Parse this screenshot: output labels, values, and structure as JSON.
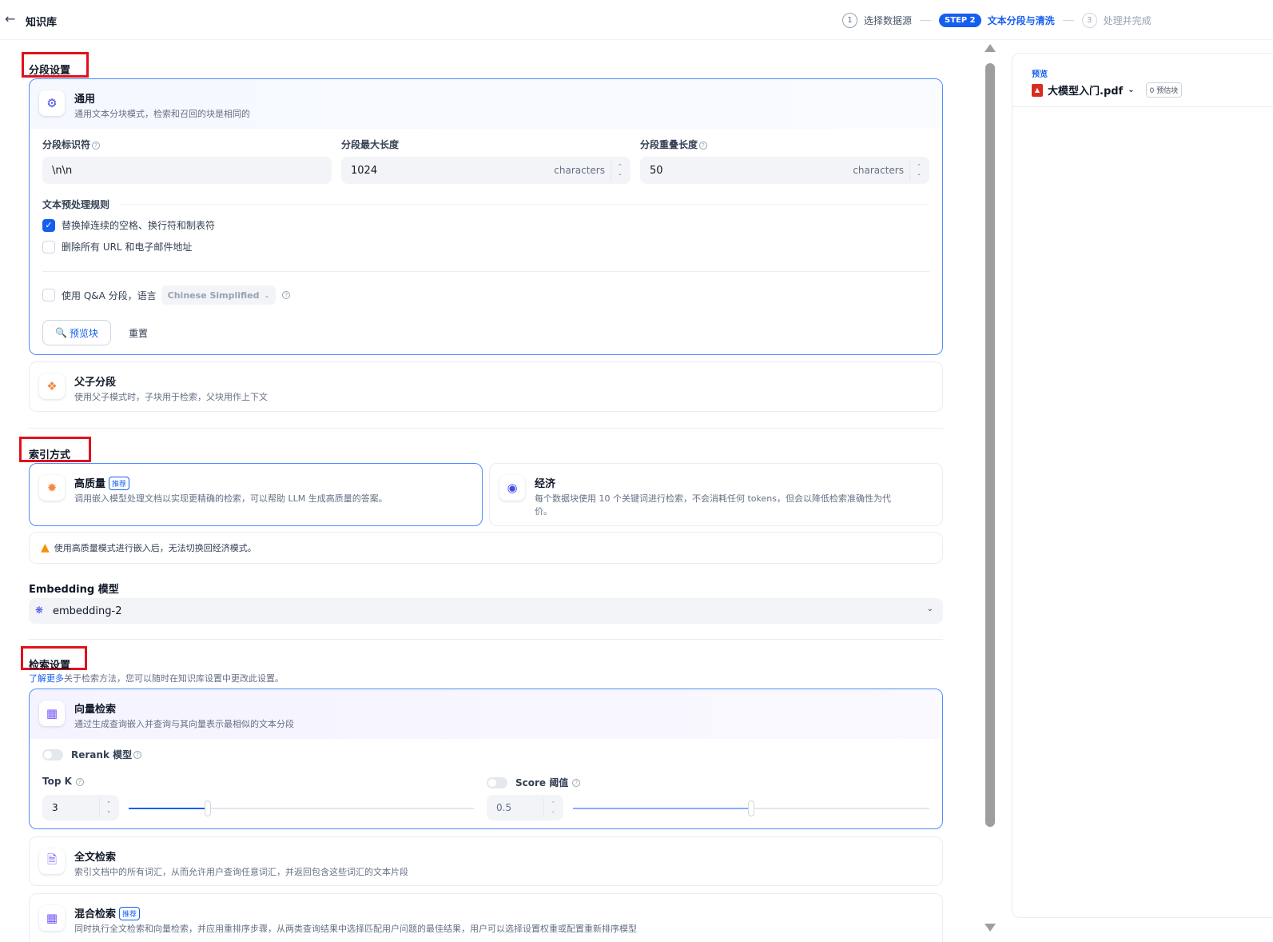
{
  "header": {
    "back_icon": "arrow-left-icon",
    "title": "知识库",
    "steps": [
      {
        "num": "1",
        "label": "选择数据源"
      },
      {
        "num": "STEP 2",
        "label": "文本分段与清洗"
      },
      {
        "num": "3",
        "label": "处理并完成"
      }
    ]
  },
  "segment": {
    "section_title": "分段设置",
    "general": {
      "icon": "gear-icon",
      "title": "通用",
      "desc": "通用文本分块模式，检索和召回的块是相同的",
      "identifier_label": "分段标识符",
      "identifier_value": "\\n\\n",
      "max_len_label": "分段最大长度",
      "max_len_value": "1024",
      "overlap_label": "分段重叠长度",
      "overlap_value": "50",
      "unit": "characters",
      "rules_label": "文本预处理规则",
      "rule1": "替换掉连续的空格、换行符和制表符",
      "rule1_checked": true,
      "rule2": "删除所有 URL 和电子邮件地址",
      "rule2_checked": false,
      "qa_label": "使用 Q&A 分段，语言",
      "qa_language": "Chinese Simplified",
      "preview_button": "预览块",
      "reset_button": "重置"
    },
    "parent_child": {
      "icon": "parent-child-icon",
      "title": "父子分段",
      "desc": "使用父子模式时，子块用于检索，父块用作上下文"
    }
  },
  "index": {
    "section_title": "索引方式",
    "high_quality": {
      "icon": "sparkle-icon",
      "title": "高质量",
      "tag": "推荐",
      "desc": "调用嵌入模型处理文档以实现更精确的检索，可以帮助 LLM 生成高质量的答案。"
    },
    "economy": {
      "icon": "piggy-bank-icon",
      "title": "经济",
      "desc_line1": "每个数据块使用 10 个关键词进行检索，不会消耗任何 tokens，但会以降低检索准确性为代",
      "desc_line2": "价。"
    },
    "warning": "使用高质量模式进行嵌入后，无法切换回经济模式。",
    "embedding_label": "Embedding 模型",
    "embedding_value": "embedding-2"
  },
  "retrieval": {
    "section_title": "检索设置",
    "learn_more": "了解更多",
    "note": "关于检索方法，您可以随时在知识库设置中更改此设置。",
    "vector": {
      "icon": "grid-icon",
      "title": "向量检索",
      "desc": "通过生成查询嵌入并查询与其向量表示最相似的文本分段",
      "rerank_label": "Rerank 模型",
      "topk_label": "Top K",
      "topk_value": "3",
      "topk_fraction": 0.23,
      "score_label": "Score 阈值",
      "score_value": "0.5",
      "score_fraction": 0.5
    },
    "fulltext": {
      "icon": "document-search-icon",
      "title": "全文检索",
      "desc": "索引文档中的所有词汇，从而允许用户查询任意词汇，并返回包含这些词汇的文本片段"
    },
    "hybrid": {
      "icon": "hybrid-grid-icon",
      "title": "混合检索",
      "tag": "推荐",
      "desc": "同时执行全文检索和向量检索，并应用重排序步骤，从两类查询结果中选择匹配用户问题的最佳结果，用户可以选择设置权重或配置重新排序模型"
    }
  },
  "preview": {
    "label": "预览",
    "file_name": "大模型入门.pdf",
    "badge": "0 预估块"
  }
}
